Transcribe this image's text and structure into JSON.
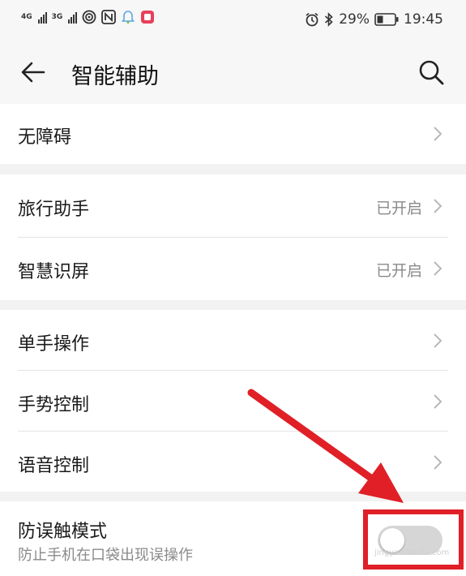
{
  "status_bar": {
    "net1": "4G",
    "net2": "3G",
    "battery": "29%",
    "time": "19:45",
    "icons": [
      "signal-icon",
      "signal-icon",
      "hotspot-icon",
      "nfc-icon",
      "notification-icon",
      "app-icon",
      "alarm-icon",
      "bluetooth-icon",
      "battery-icon"
    ]
  },
  "header": {
    "title": "智能辅助"
  },
  "groups": {
    "accessibility": {
      "label": "无障碍"
    },
    "travel": {
      "label": "旅行助手",
      "value": "已开启"
    },
    "smart_screen": {
      "label": "智慧识屏",
      "value": "已开启"
    },
    "one_hand": {
      "label": "单手操作"
    },
    "gesture": {
      "label": "手势控制"
    },
    "voice": {
      "label": "语音控制"
    },
    "mistouch": {
      "label": "防误触模式",
      "subtitle": "防止手机在口袋出现误操作",
      "enabled": false
    }
  },
  "watermark": "jingyan.baidu.com",
  "colors": {
    "annotation": "#e01f27",
    "background": "#f2f2f2",
    "card": "#ffffff"
  }
}
